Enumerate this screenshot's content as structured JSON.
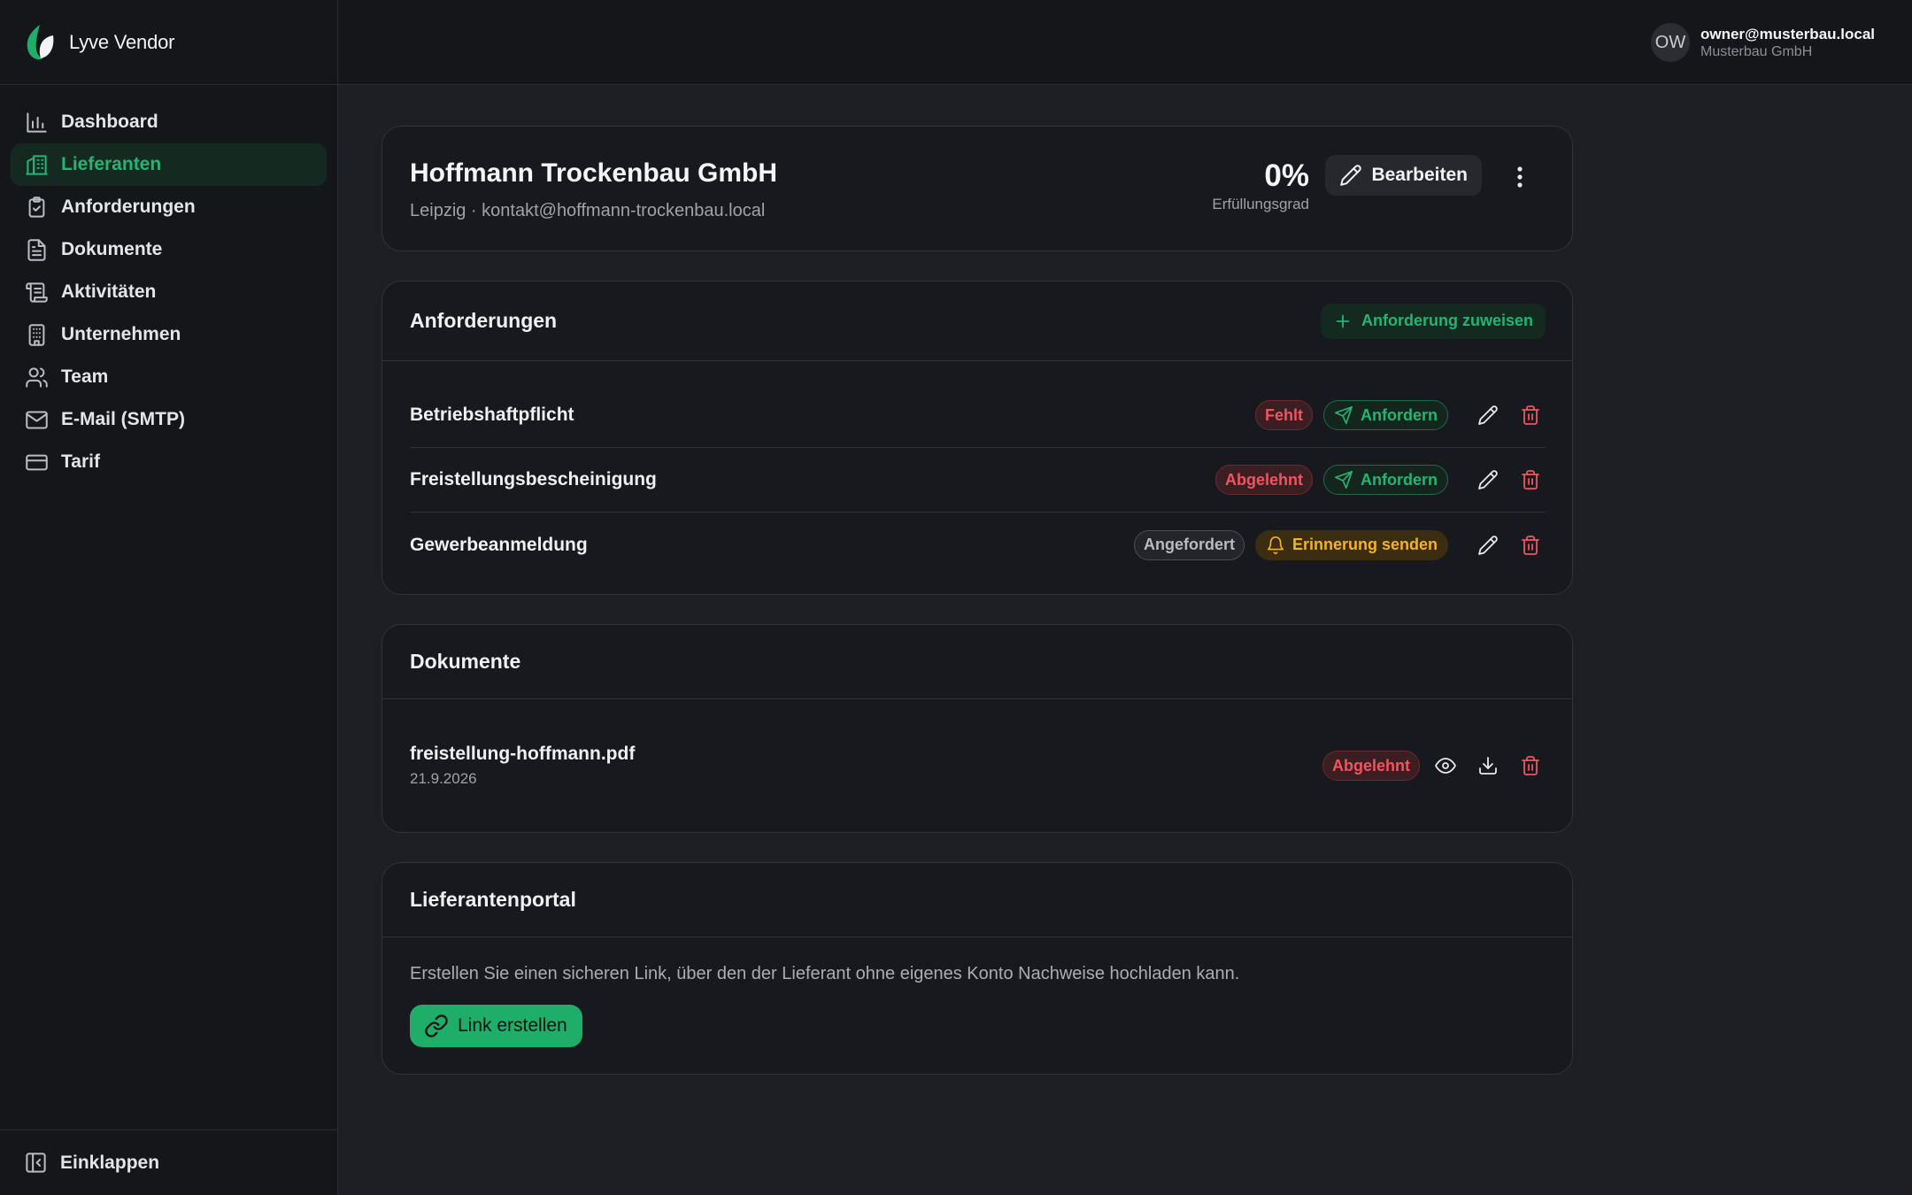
{
  "brand": {
    "name": "Lyve Vendor",
    "logo_icon": "leaf-logo-icon"
  },
  "sidebar": {
    "items": [
      {
        "label": "Dashboard",
        "icon": "bar-chart-icon",
        "active": false
      },
      {
        "label": "Lieferanten",
        "icon": "building-icon",
        "active": true
      },
      {
        "label": "Anforderungen",
        "icon": "clipboard-check-icon",
        "active": false
      },
      {
        "label": "Dokumente",
        "icon": "file-text-icon",
        "active": false
      },
      {
        "label": "Aktivitäten",
        "icon": "scroll-icon",
        "active": false
      },
      {
        "label": "Unternehmen",
        "icon": "office-building-icon",
        "active": false
      },
      {
        "label": "Team",
        "icon": "users-icon",
        "active": false
      },
      {
        "label": "E-Mail (SMTP)",
        "icon": "mail-icon",
        "active": false
      },
      {
        "label": "Tarif",
        "icon": "credit-card-icon",
        "active": false
      }
    ],
    "collapse_label": "Einklappen"
  },
  "user": {
    "initials": "OW",
    "email": "owner@musterbau.local",
    "company": "Musterbau GmbH"
  },
  "supplier": {
    "name": "Hoffmann Trockenbau GmbH",
    "subtitle": "Leipzig · kontakt@hoffmann-trockenbau.local",
    "score_value": "0%",
    "score_label": "Erfüllungsgrad",
    "edit_label": "Bearbeiten"
  },
  "requirements": {
    "title": "Anforderungen",
    "assign_label": "Anforderung zuweisen",
    "rows": [
      {
        "name": "Betriebshaftpflicht",
        "status": "Fehlt",
        "status_color": "red",
        "action": "Anfordern",
        "action_type": "green"
      },
      {
        "name": "Freistellungsbescheinigung",
        "status": "Abgelehnt",
        "status_color": "red",
        "action": "Anfordern",
        "action_type": "green"
      },
      {
        "name": "Gewerbeanmeldung",
        "status": "Angefordert",
        "status_color": "gray",
        "action": "Erinnerung senden",
        "action_type": "yellow"
      }
    ]
  },
  "documents": {
    "title": "Dokumente",
    "items": [
      {
        "name": "freistellung-hoffmann.pdf",
        "date": "21.9.2026",
        "status": "Abgelehnt"
      }
    ]
  },
  "portal": {
    "title": "Lieferantenportal",
    "description": "Erstellen Sie einen sicheren Link, über den der Lieferant ohne eigenes Konto Nachweise hochladen kann.",
    "button_label": "Link erstellen"
  },
  "colors": {
    "accent": "#22b573",
    "danger": "#f2545f",
    "warning": "#f5b323",
    "background": "#1d1f25",
    "sidebar": "#15161a"
  }
}
